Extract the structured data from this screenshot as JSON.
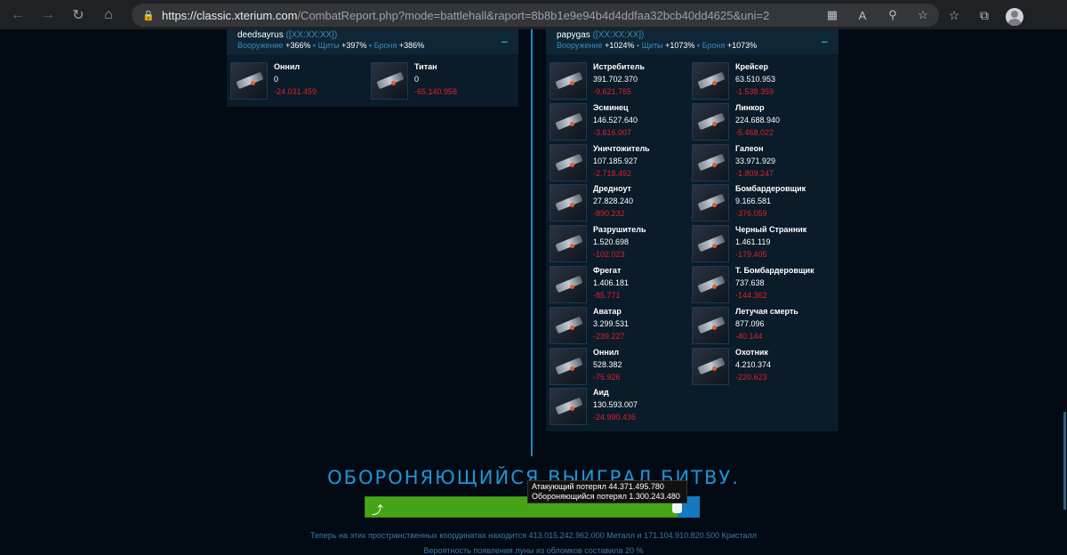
{
  "browser": {
    "url_host": "https://classic.xterium.com",
    "url_path": "/CombatReport.php?mode=battlehall&raport=8b8b1e9e94b4d4ddfaa32bcb40dd4625&uni=2",
    "icons": [
      "back-arrow-icon",
      "forward-arrow-icon",
      "reload-icon",
      "home-icon",
      "lock-icon",
      "apps-icon",
      "read-aloud-icon",
      "zoom-icon",
      "favorite-add-icon",
      "favorites-icon",
      "collections-icon",
      "profile-icon"
    ]
  },
  "attacker": {
    "name": "deedsayrus",
    "coords": "([XX:XX:XX])",
    "weapons_label": "Вооружение",
    "weapons": "+366%",
    "shields_label": "Щиты",
    "shields": "+397%",
    "armor_label": "Броня",
    "armor": "+386%",
    "ships": [
      {
        "name": "Оннил",
        "count": "0",
        "loss": "-24.031.459"
      },
      {
        "name": "Титан",
        "count": "0",
        "loss": "-65.140.958"
      }
    ]
  },
  "defender": {
    "name": "papygas",
    "coords": "([XX:XX:XX])",
    "weapons_label": "Вооружение",
    "weapons": "+1024%",
    "shields_label": "Щиты",
    "shields": "+1073%",
    "armor_label": "Броня",
    "armor": "+1073%",
    "ships": [
      {
        "name": "Истребитель",
        "count": "391.702.370",
        "loss": "-9.621.765"
      },
      {
        "name": "Крейсер",
        "count": "63.510.953",
        "loss": "-1.538.359"
      },
      {
        "name": "Эсминец",
        "count": "146.527.640",
        "loss": "-3.616.007"
      },
      {
        "name": "Линкор",
        "count": "224.688.940",
        "loss": "-5.468.022"
      },
      {
        "name": "Уничтожитель",
        "count": "107.185.927",
        "loss": "-2.718.492"
      },
      {
        "name": "Галеон",
        "count": "33.971.929",
        "loss": "-1.809.247"
      },
      {
        "name": "Дредноут",
        "count": "27.828.240",
        "loss": "-890.232"
      },
      {
        "name": "Бомбардеровщик",
        "count": "9.166.581",
        "loss": "-376.059"
      },
      {
        "name": "Разрушитель",
        "count": "1.520.698",
        "loss": "-102.023"
      },
      {
        "name": "Черный Странник",
        "count": "1.461.119",
        "loss": "-179.405"
      },
      {
        "name": "Фрегат",
        "count": "1.406.181",
        "loss": "-85.771"
      },
      {
        "name": "Т. Бомбардеровщик",
        "count": "737.638",
        "loss": "-144.362"
      },
      {
        "name": "Аватар",
        "count": "3.299.531",
        "loss": "-239.227"
      },
      {
        "name": "Летучая смерть",
        "count": "877.096",
        "loss": "-40.144"
      },
      {
        "name": "Оннил",
        "count": "528.382",
        "loss": "-75.926"
      },
      {
        "name": "Охотник",
        "count": "4.210.374",
        "loss": "-220.623"
      },
      {
        "name": "Аид",
        "count": "130.593.007",
        "loss": "-24.990.436"
      }
    ]
  },
  "result": {
    "winner_text": "ОБОРОНЯЮЩИЙСЯ ВЫИГРАЛ БИТВУ.",
    "attacker_loss_text": "Атакующий потерял 44.371.495.780",
    "defender_loss_text": "Обороняющийся потерял 1.300.243.480",
    "bar_green_fraction": 0.968,
    "debris_text": "Теперь на этих пространственных координатах находится 413.015.242.962.000 Металл и 171.104.910.820.500 Кристалл",
    "moon_text": "Вероятность появления луны из обломков составила 20 %"
  },
  "colors": {
    "accent": "#1e96d8",
    "loss": "#e0202a",
    "bar_green": "#46a418",
    "bar_blue": "#1678c0"
  }
}
